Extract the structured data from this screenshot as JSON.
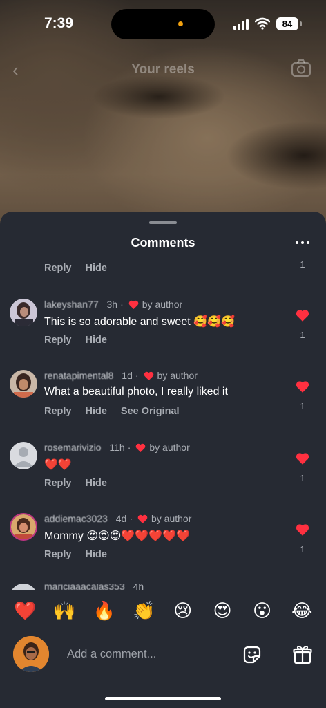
{
  "status_bar": {
    "time": "7:39",
    "battery": "84"
  },
  "reel_header": {
    "title": "Your reels",
    "back_icon": "chevron-left-icon",
    "camera_icon": "camera-icon"
  },
  "comments_sheet": {
    "title": "Comments",
    "more_icon": "more-horizontal-icon",
    "first_actions": {
      "reply": "Reply",
      "hide": "Hide",
      "like_count": "1"
    },
    "comments": [
      {
        "username": "lakeyshan77",
        "time": "3h",
        "by_author": "by author",
        "text": "This is so adorable and sweet 🥰🥰🥰",
        "reply": "Reply",
        "hide": "Hide",
        "see_original": "",
        "likes": "1"
      },
      {
        "username": "renatapimental8",
        "time": "1d",
        "by_author": "by author",
        "text": "What a beautiful photo, I really liked it",
        "reply": "Reply",
        "hide": "Hide",
        "see_original": "See Original",
        "likes": "1"
      },
      {
        "username": "rosemarivizio",
        "time": "11h",
        "by_author": "by author",
        "text": "❤️❤️",
        "reply": "Reply",
        "hide": "Hide",
        "see_original": "",
        "likes": "1"
      },
      {
        "username": "addiemac3023",
        "time": "4d",
        "by_author": "by author",
        "text": "Mommy 😍😍😍❤️❤️❤️❤️❤️",
        "reply": "Reply",
        "hide": "Hide",
        "see_original": "",
        "likes": "1"
      }
    ],
    "peek": {
      "username": "mariciaaacalas353",
      "time": "4h"
    }
  },
  "emoji_bar": [
    "❤️",
    "🙌",
    "🔥",
    "👏",
    "😢",
    "😍",
    "😮",
    "😂"
  ],
  "composer": {
    "placeholder": "Add a comment...",
    "sticker_icon": "sticker-icon",
    "gift_icon": "gift-icon"
  },
  "colors": {
    "sheet_bg": "#262a33",
    "heart": "#ff3040",
    "muted_text": "#a9adb4"
  }
}
